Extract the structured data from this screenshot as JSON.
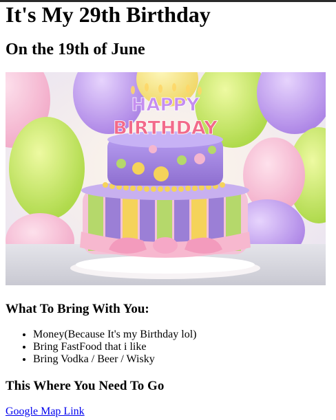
{
  "page": {
    "title": "It's My 29th Birthday",
    "date_heading": "On the 19th of June"
  },
  "photo": {
    "cake_topper_line1": "HAPPY",
    "cake_topper_line2": "BIRTHDAY"
  },
  "bring": {
    "heading": "What To Bring With You:",
    "items": [
      "Money(Because It's my Birthday lol)",
      "Bring FastFood that i like",
      "Bring Vodka / Beer / Wisky"
    ]
  },
  "location": {
    "heading": "This Where You Need To Go",
    "link_text": "Google Map Link"
  },
  "colors": {
    "link": "#0000ee",
    "cake_purple": "#9b7fd6",
    "cake_pink": "#f4b6cf",
    "cake_green": "#b5d86b",
    "cake_yellow": "#f5d35a"
  }
}
